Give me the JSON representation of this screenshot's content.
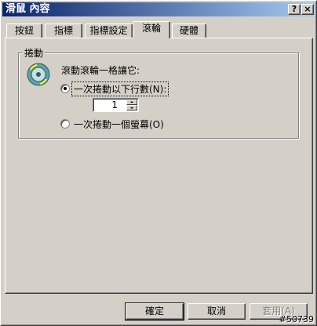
{
  "window": {
    "title": "滑鼠 內容",
    "help_glyph": "?",
    "close_glyph": "×"
  },
  "tabs": [
    {
      "label": "按鈕",
      "active": false
    },
    {
      "label": "指標",
      "active": false
    },
    {
      "label": "指標設定",
      "active": false
    },
    {
      "label": "滾輪",
      "active": true
    },
    {
      "label": "硬體",
      "active": false
    }
  ],
  "scroll_group": {
    "legend": "捲動",
    "description": "滾動滾輪一格讓它:",
    "option_lines": {
      "label": "一次捲動以下行數(N):",
      "selected": true
    },
    "lines_value": "1",
    "option_screen": {
      "label": "一次捲動一個螢幕(O)",
      "selected": false
    }
  },
  "buttons": {
    "ok": "確定",
    "cancel": "取消",
    "apply": "套用(A)"
  },
  "watermark": "#50739",
  "icons": {
    "mouse_wheel": "mouse-wheel-icon"
  },
  "colors": {
    "titlebar_start": "#0a246a",
    "titlebar_end": "#a6caf0",
    "face": "#d4d0c8"
  }
}
